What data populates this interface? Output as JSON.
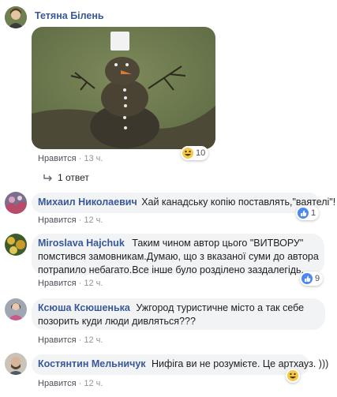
{
  "comments": [
    {
      "author": "Тетяна Білень",
      "like_label": "Нравится",
      "time": "13 ч.",
      "reaction_count": "10",
      "reaction_icon": "haha-icon"
    },
    {
      "author": "Михаил Николаевич",
      "text": "Хай канадську копію поставлять,\"ваятелі\"!",
      "like_label": "Нравится",
      "time": "12 ч.",
      "reaction_count": "1",
      "reaction_icon": "like-icon"
    },
    {
      "author": "Miroslava Hajchuk",
      "text_line1": "Таким чином автор цього \"ВИТВОРУ\"",
      "text_line2": "помстився замовникам.Думаю, що з вказаної суми до автора",
      "text_line3": "потрапило небагато.Все інше було розділено заздалегідь.",
      "like_label": "Нравится",
      "time": "12 ч.",
      "reaction_count": "9",
      "reaction_icon": "like-icon"
    },
    {
      "author": "Ксюша Ксюшенька",
      "text_line1": "Ужгород туристичне місто а так себе",
      "text_line2": "позорить куди люди дивляться???",
      "like_label": "Нравится",
      "time": "12 ч."
    },
    {
      "author": "Костянтин Мельничук",
      "text": "Нифіга ви не розумієте. Це артхауз. )))",
      "like_label": "Нравится",
      "time": "12 ч.",
      "reaction_icon": "haha-icon"
    }
  ],
  "replies": {
    "label": "1 ответ"
  },
  "separator": "·",
  "colors": {
    "name": "#385898",
    "bubble": "#f2f3f5",
    "meta": "#90949c",
    "like_blue": "#4b88f6",
    "haha_yellow": "#f7c844"
  }
}
